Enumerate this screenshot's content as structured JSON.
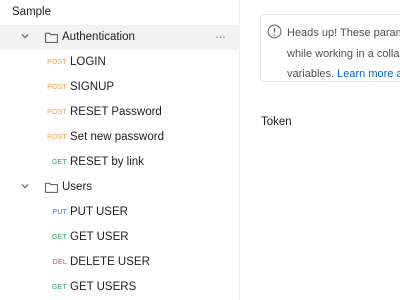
{
  "collection": {
    "name": "Sample"
  },
  "folders": [
    {
      "name": "Authentication",
      "requests": [
        {
          "method": "POST",
          "name": "LOGIN"
        },
        {
          "method": "POST",
          "name": "SIGNUP"
        },
        {
          "method": "POST",
          "name": "RESET Password"
        },
        {
          "method": "POST",
          "name": "Set new password"
        },
        {
          "method": "GET",
          "name": "RESET by link"
        }
      ]
    },
    {
      "name": "Users",
      "requests": [
        {
          "method": "PUT",
          "name": "PUT USER"
        },
        {
          "method": "GET",
          "name": "GET USER"
        },
        {
          "method": "DEL",
          "name": "DELETE USER"
        },
        {
          "method": "GET",
          "name": "GET USERS"
        }
      ]
    }
  ],
  "method_colors": {
    "POST": "#f0a34a",
    "GET": "#2aa36a",
    "PUT": "#2f7bd6",
    "DEL": "#d8403f"
  },
  "more_icon": "…",
  "notice": {
    "icon": "info-icon",
    "line1": "Heads up! These paramet",
    "line2": "while working in a collabo",
    "line3_prefix": "variables. ",
    "line3_link": "Learn more abo"
  },
  "main": {
    "token_label": "Token"
  }
}
